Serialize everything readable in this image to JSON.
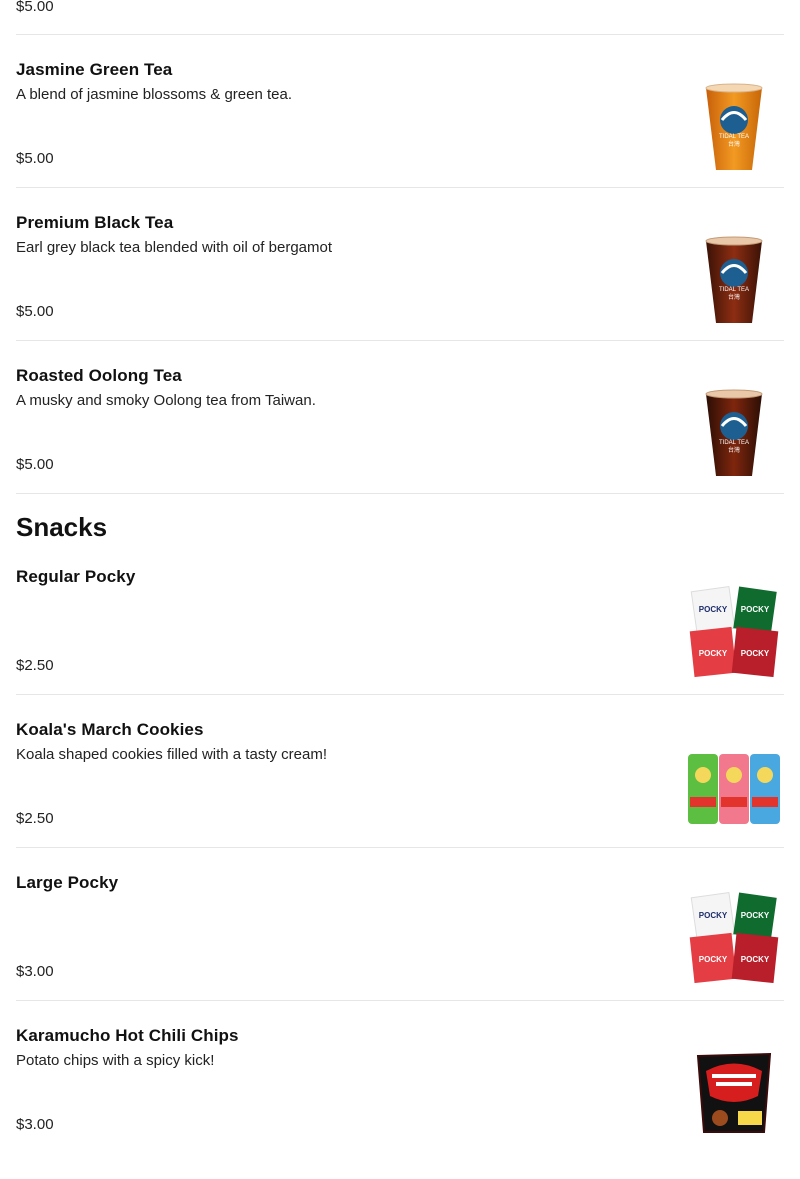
{
  "menu": {
    "top_price": "$5.00",
    "tea_items": [
      {
        "name": "Jasmine Green Tea",
        "description": "A blend of jasmine blossoms & green tea.",
        "price": "$5.00",
        "image": "tea-cup-orange"
      },
      {
        "name": "Premium Black Tea",
        "description": "Earl grey black tea blended with oil of bergamot",
        "price": "$5.00",
        "image": "tea-cup-dark"
      },
      {
        "name": "Roasted Oolong Tea",
        "description": "A musky and smoky Oolong tea from Taiwan.",
        "price": "$5.00",
        "image": "tea-cup-dark"
      }
    ],
    "snacks_title": "Snacks",
    "snack_items": [
      {
        "name": "Regular Pocky",
        "description": "",
        "price": "$2.50",
        "image": "pocky-boxes"
      },
      {
        "name": "Koala's March Cookies",
        "description": "Koala shaped cookies filled with a tasty cream!",
        "price": "$2.50",
        "image": "koala-march-boxes"
      },
      {
        "name": "Large Pocky",
        "description": "",
        "price": "$3.00",
        "image": "pocky-boxes"
      },
      {
        "name": "Karamucho Hot Chili Chips",
        "description": "Potato chips with a spicy kick!",
        "price": "$3.00",
        "image": "chips-bag"
      }
    ],
    "cup_brand": "TIDAL TEA",
    "cup_brand_cn": "台灣",
    "pocky_label": "POCKY"
  }
}
